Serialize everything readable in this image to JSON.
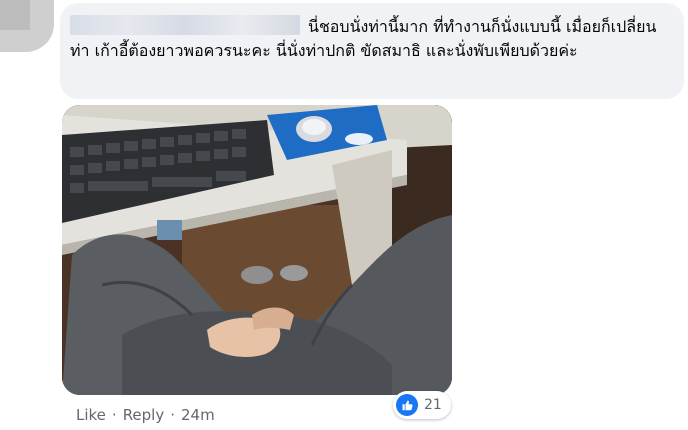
{
  "comment": {
    "text": "นี่ชอบนั่งท่านี้มาก ที่ทำงานก็นั่งแบบนี้ เมื่อยก็เปลี่ยนท่า เก้าอี้ต้องยาวพอควรนะคะ นี่นั่งท่าปกติ ขัดสมาธิ และนั่งพับเพียบด้วยค่ะ"
  },
  "actions": {
    "like_label": "Like",
    "reply_label": "Reply",
    "separator": "·",
    "time": "24m"
  },
  "reactions": {
    "icon": "thumbs-up-icon",
    "count": "21",
    "color": "#1877f2"
  }
}
